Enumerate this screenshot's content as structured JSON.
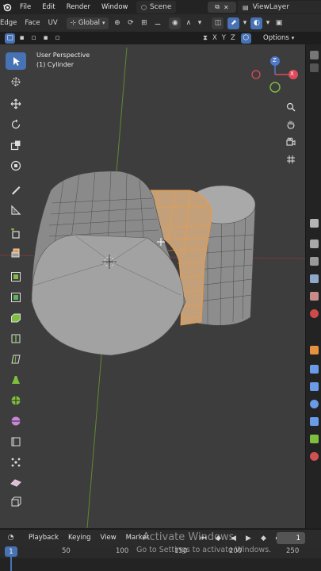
{
  "topbar": {
    "menus": [
      "File",
      "Edit",
      "Render",
      "Window"
    ],
    "scene_label": "Scene",
    "view_layer": "ViewLayer"
  },
  "header": {
    "menus": [
      "Edge",
      "Face",
      "UV"
    ],
    "orientation": "Global",
    "axes": [
      "X",
      "Y",
      "Z"
    ],
    "options": "Options"
  },
  "viewport": {
    "perspective": "User Perspective",
    "object": "(1) Cylinder",
    "gizmo_axes": [
      "X",
      "Y",
      "Z"
    ]
  },
  "timeline": {
    "menus": [
      "Playback",
      "Keying",
      "View",
      "Marker"
    ],
    "current_frame": "1",
    "frame_field": "1",
    "ticks": [
      "50",
      "100",
      "150",
      "200",
      "250"
    ]
  },
  "watermark": {
    "line1": "Activate Windows",
    "line2": "Go to Settings to activate Windows."
  },
  "colors": {
    "accent": "#4772b3",
    "selection": "#f29b3c",
    "viewport_bg": "#3d3d3d"
  }
}
